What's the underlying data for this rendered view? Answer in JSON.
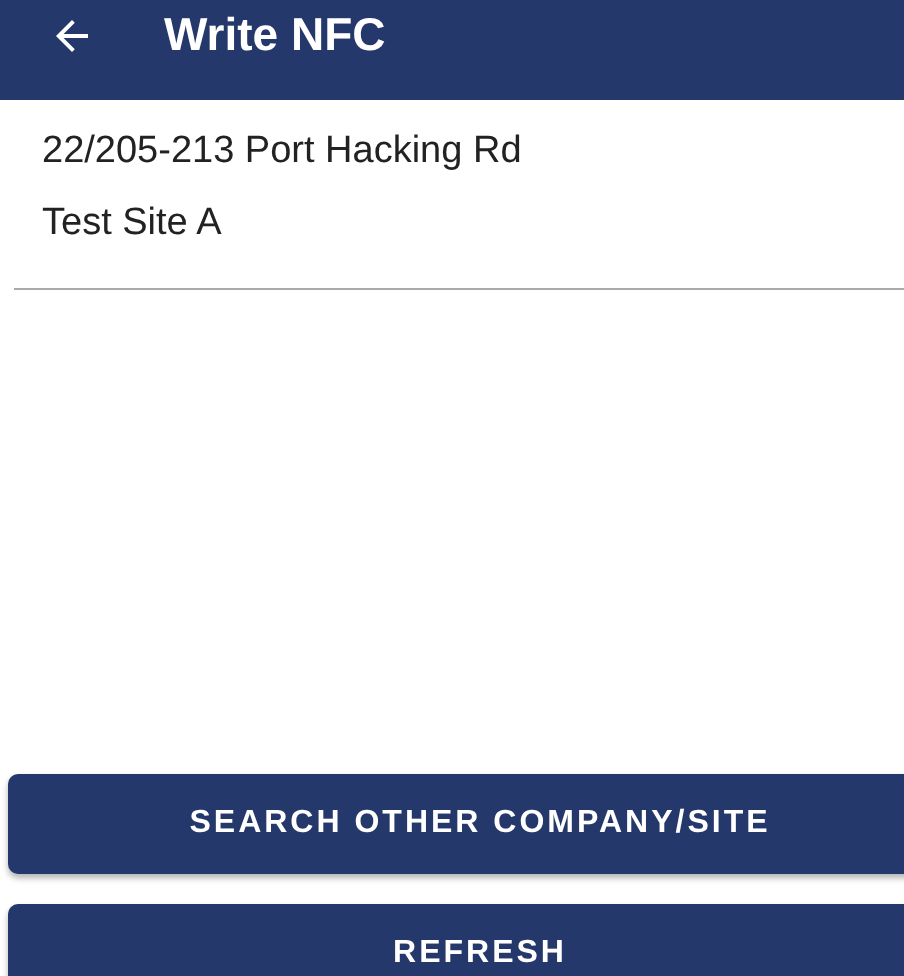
{
  "app_bar": {
    "title": "Write NFC"
  },
  "site": {
    "address": "22/205-213 Port Hacking Rd",
    "name": "Test Site A"
  },
  "buttons": [
    {
      "label": "SEARCH OTHER COMPANY/SITE"
    },
    {
      "label": "REFRESH"
    }
  ]
}
